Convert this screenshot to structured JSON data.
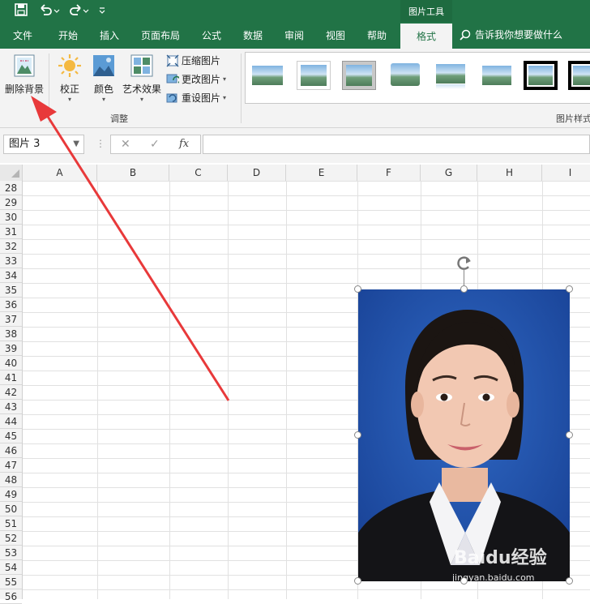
{
  "qat": {
    "save_icon": "save-icon",
    "undo_icon": "undo-icon",
    "redo_icon": "redo-icon",
    "customize_icon": "customize-qat-icon"
  },
  "context_tab_group": "图片工具",
  "tabs": [
    "文件",
    "开始",
    "插入",
    "页面布局",
    "公式",
    "数据",
    "审阅",
    "视图",
    "帮助"
  ],
  "active_tab": "格式",
  "tell_me": "告诉我你想要做什么",
  "ribbon": {
    "remove_background": "删除背景",
    "corrections": "校正",
    "color": "颜色",
    "artistic_effects": "艺术效果",
    "compress_pictures": "压缩图片",
    "change_picture": "更改图片",
    "reset_picture": "重设图片",
    "adjust_group": "调整",
    "picture_styles_group": "图片样式"
  },
  "name_box": "图片 3",
  "formula_bar": {
    "cancel": "✕",
    "enter": "✓",
    "fx": "fx",
    "value": ""
  },
  "columns": [
    "A",
    "B",
    "C",
    "D",
    "E",
    "F",
    "G",
    "H",
    "I"
  ],
  "rows": [
    "28",
    "29",
    "30",
    "31",
    "32",
    "33",
    "34",
    "35",
    "36",
    "37",
    "38",
    "39",
    "40",
    "41",
    "42",
    "43",
    "44",
    "45",
    "46",
    "47",
    "48",
    "49",
    "50",
    "51",
    "52",
    "53",
    "54",
    "55",
    "56"
  ],
  "watermark": {
    "brand": "Baidu经验",
    "url": "jingyan.baidu.com"
  },
  "colors": {
    "excel_green": "#217346",
    "arrow_red": "#e8393a",
    "photo_blue": "#1c4fa6"
  }
}
